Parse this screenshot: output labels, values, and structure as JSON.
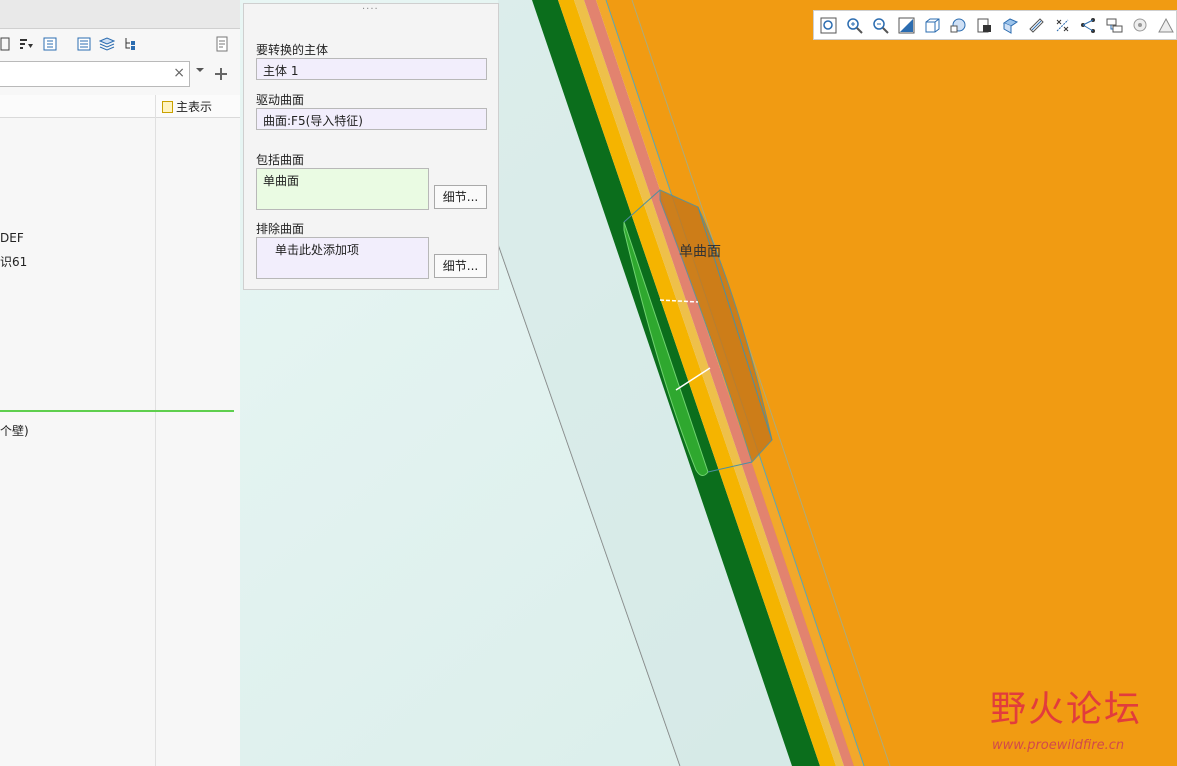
{
  "tree": {
    "search_value": "",
    "clear_symbol": "×",
    "column_header": "主表示",
    "rows": [
      "DEF",
      "识61",
      "个壁)"
    ]
  },
  "dialog": {
    "grip": "····",
    "body_label": "要转换的主体",
    "body_value": "主体 1",
    "drive_label": "驱动曲面",
    "drive_value": "曲面:F5(导入特征)",
    "include_label": "包括曲面",
    "include_value": "单曲面",
    "include_detail": "细节...",
    "exclude_label": "排除曲面",
    "exclude_value": "单击此处添加项",
    "exclude_detail": "细节..."
  },
  "viewport": {
    "surface_label": "单曲面"
  },
  "watermark": {
    "text": "野火论坛",
    "url": "www.proewildfire.cn"
  },
  "colors": {
    "orange": "#f19b12",
    "dark_green": "#0b6e1c",
    "yellow": "#f5b400",
    "salmon": "#e2836f",
    "teal_bg": "#e6f4f1",
    "highlight_green": "#2fa82f"
  },
  "icons": {
    "tree_toolbar": [
      "show-tree-icon",
      "filter-icon",
      "settings-icon",
      "columns-icon",
      "layers-icon",
      "tree-options-icon",
      "notes-icon"
    ],
    "view_toolbar": [
      "zoom-fit-icon",
      "zoom-in-icon",
      "zoom-out-icon",
      "repaint-icon",
      "saved-views-icon",
      "orientation-icon",
      "display-style-icon",
      "section-icon",
      "datum-display-icon",
      "point-display-icon",
      "csys-display-icon",
      "annotations-icon",
      "spin-center-icon",
      "appearance-icon"
    ]
  }
}
